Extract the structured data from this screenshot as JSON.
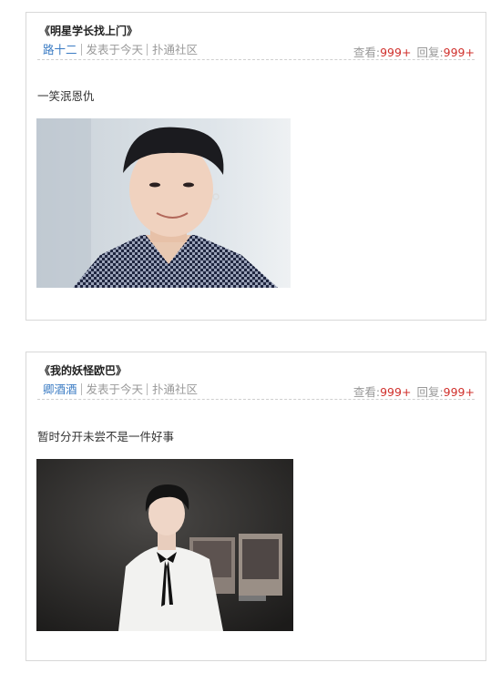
{
  "posts": [
    {
      "title": "《明星学长找上门》",
      "author": "路十二",
      "posted": "发表于今天",
      "community": "扑通社区",
      "views_label": "查看:",
      "views": "999+",
      "replies_label": "回复:",
      "replies": "999+",
      "excerpt": "一笑泯恩仇"
    },
    {
      "title": "《我的妖怪欧巴》",
      "author": "卿酒酒",
      "posted": "发表于今天",
      "community": "扑通社区",
      "views_label": "查看:",
      "views": "999+",
      "replies_label": "回复:",
      "replies": "999+",
      "excerpt": "暂时分开未尝不是一件好事"
    }
  ],
  "colors": {
    "author": "#3b7cc4",
    "count": "#d0302c",
    "meta": "#999999",
    "border": "#d8d8d8"
  }
}
